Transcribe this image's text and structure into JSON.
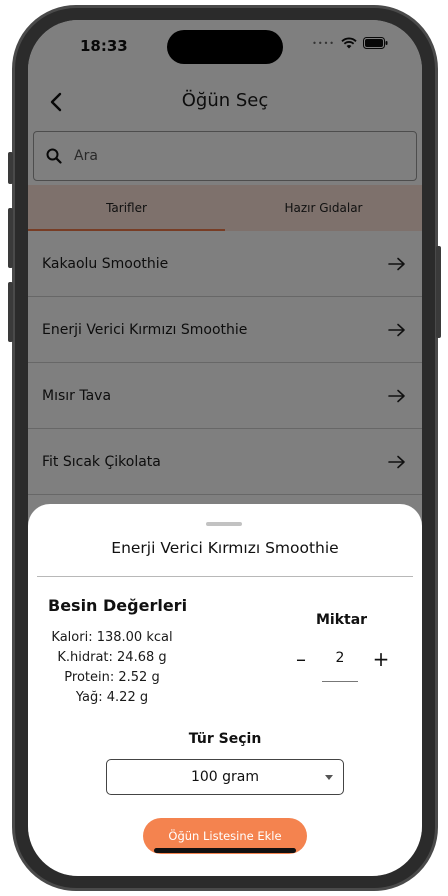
{
  "status_bar": {
    "time": "18:33",
    "icons": [
      "cellular-dots-icon",
      "wifi-icon",
      "battery-icon"
    ]
  },
  "header": {
    "title": "Öğün Seç",
    "back_icon": "chevron-left-icon"
  },
  "search": {
    "placeholder": "Ara",
    "icon": "search-icon"
  },
  "tabs": [
    {
      "label": "Tarifler",
      "active": true
    },
    {
      "label": "Hazır Gıdalar",
      "active": false
    }
  ],
  "recipes": [
    {
      "name": "Kakaolu Smoothie"
    },
    {
      "name": "Enerji Verici Kırmızı Smoothie"
    },
    {
      "name": "Mısır Tava"
    },
    {
      "name": "Fit Sıcak Çikolata"
    }
  ],
  "sheet": {
    "title": "Enerji Verici Kırmızı Smoothie",
    "nutrition": {
      "title": "Besin Değerleri",
      "calories": "Kalori: 138.00 kcal",
      "carbs": "K.hidrat: 24.68 g",
      "protein": "Protein: 2.52 g",
      "fat": "Yağ: 4.22 g"
    },
    "quantity": {
      "label": "Miktar",
      "minus": "–",
      "value": "2",
      "plus": "+"
    },
    "type": {
      "label": "Tür Seçin",
      "selected": "100 gram"
    },
    "add_button": "Öğün Listesine Ekle"
  },
  "colors": {
    "accent": "#f4834f",
    "tab_background": "#fde3d8",
    "tab_indicator": "#f07a4a",
    "overlay": "rgba(0,0,0,0.5)"
  }
}
